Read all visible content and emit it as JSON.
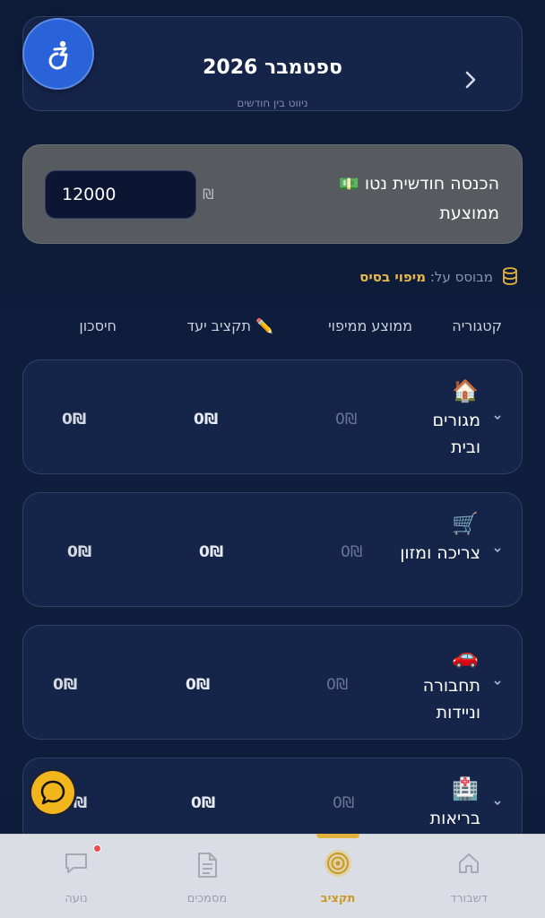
{
  "header": {
    "title": "ספטמבר 2026",
    "subtitle": "ניווט בין חודשים"
  },
  "income": {
    "emoji": "💵",
    "label": "הכנסה חודשית נטו ממוצעת",
    "currency": "₪",
    "value": "12000"
  },
  "based_on": {
    "prefix": "מבוסס על:",
    "link": "מיפוי בסיס"
  },
  "columns": {
    "category": "קטגוריה",
    "avg": "ממוצע ממיפוי",
    "budget": "תקציב יעד ✏️",
    "savings": "חיסכון"
  },
  "rows": [
    {
      "emoji": "🏠",
      "name": "מגורים ובית",
      "avg": "0₪",
      "budget": "0₪",
      "savings": "0₪"
    },
    {
      "emoji": "🛒",
      "name": "צריכה ומזון",
      "avg": "0₪",
      "budget": "0₪",
      "savings": "0₪"
    },
    {
      "emoji": "🚗",
      "name": "תחבורה וניידות",
      "avg": "0₪",
      "budget": "0₪",
      "savings": "0₪"
    },
    {
      "emoji": "🏥",
      "name": "בריאות",
      "avg": "0₪",
      "budget": "0₪",
      "savings": "0₪"
    }
  ],
  "nav": {
    "items": [
      {
        "label": "דשבורד",
        "icon": "home-icon"
      },
      {
        "label": "תקציב",
        "icon": "target-icon",
        "active": true
      },
      {
        "label": "מסמכים",
        "icon": "document-icon"
      },
      {
        "label": "נועה",
        "icon": "chat-icon"
      }
    ]
  },
  "colors": {
    "background": "#0f1e3d",
    "accent": "#e2b23c",
    "a11y": "#2a63d9"
  }
}
